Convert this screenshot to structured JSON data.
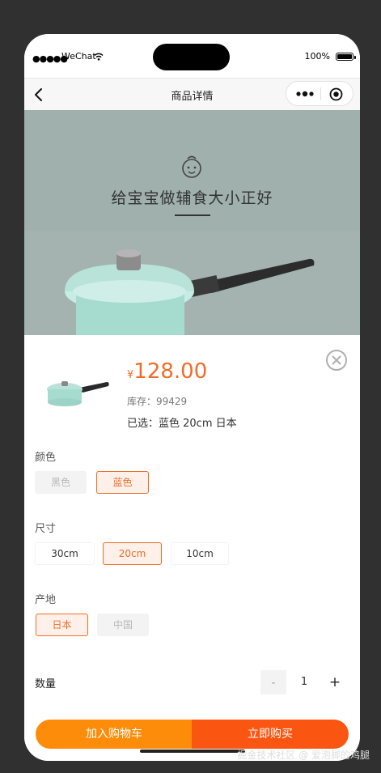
{
  "status_bar": {
    "signal": "●●●●●",
    "carrier": "WeChat",
    "battery": "100%"
  },
  "nav": {
    "title": "商品详情"
  },
  "banner": {
    "caption": "给宝宝做辅食大小正好"
  },
  "product": {
    "currency": "¥",
    "price": "128.00",
    "stock": "库存：99429",
    "selected": "已选：蓝色 20cm 日本"
  },
  "options": [
    {
      "title": "颜色",
      "values": [
        {
          "label": "黑色",
          "state": "disabled"
        },
        {
          "label": "蓝色",
          "state": "active"
        }
      ]
    },
    {
      "title": "尺寸",
      "values": [
        {
          "label": "30cm",
          "state": "normal"
        },
        {
          "label": "20cm",
          "state": "active"
        },
        {
          "label": "10cm",
          "state": "normal"
        }
      ]
    },
    {
      "title": "产地",
      "values": [
        {
          "label": "日本",
          "state": "active"
        },
        {
          "label": "中国",
          "state": "disabled"
        }
      ]
    }
  ],
  "quantity": {
    "label": "数量",
    "minus": "-",
    "value": "1",
    "plus": "+"
  },
  "actions": {
    "add_to_cart": "加入购物车",
    "buy_now": "立即购买"
  },
  "watermark": "掘金技术社区 @ 爱泡脚的鸡腿",
  "colors": {
    "accent": "#f06d28",
    "cart_button": "#fd8c0a",
    "buy_button": "#fb5512",
    "chip_active_bg": "#fff1ea",
    "chip_disabled_bg": "#f3f3f3"
  }
}
